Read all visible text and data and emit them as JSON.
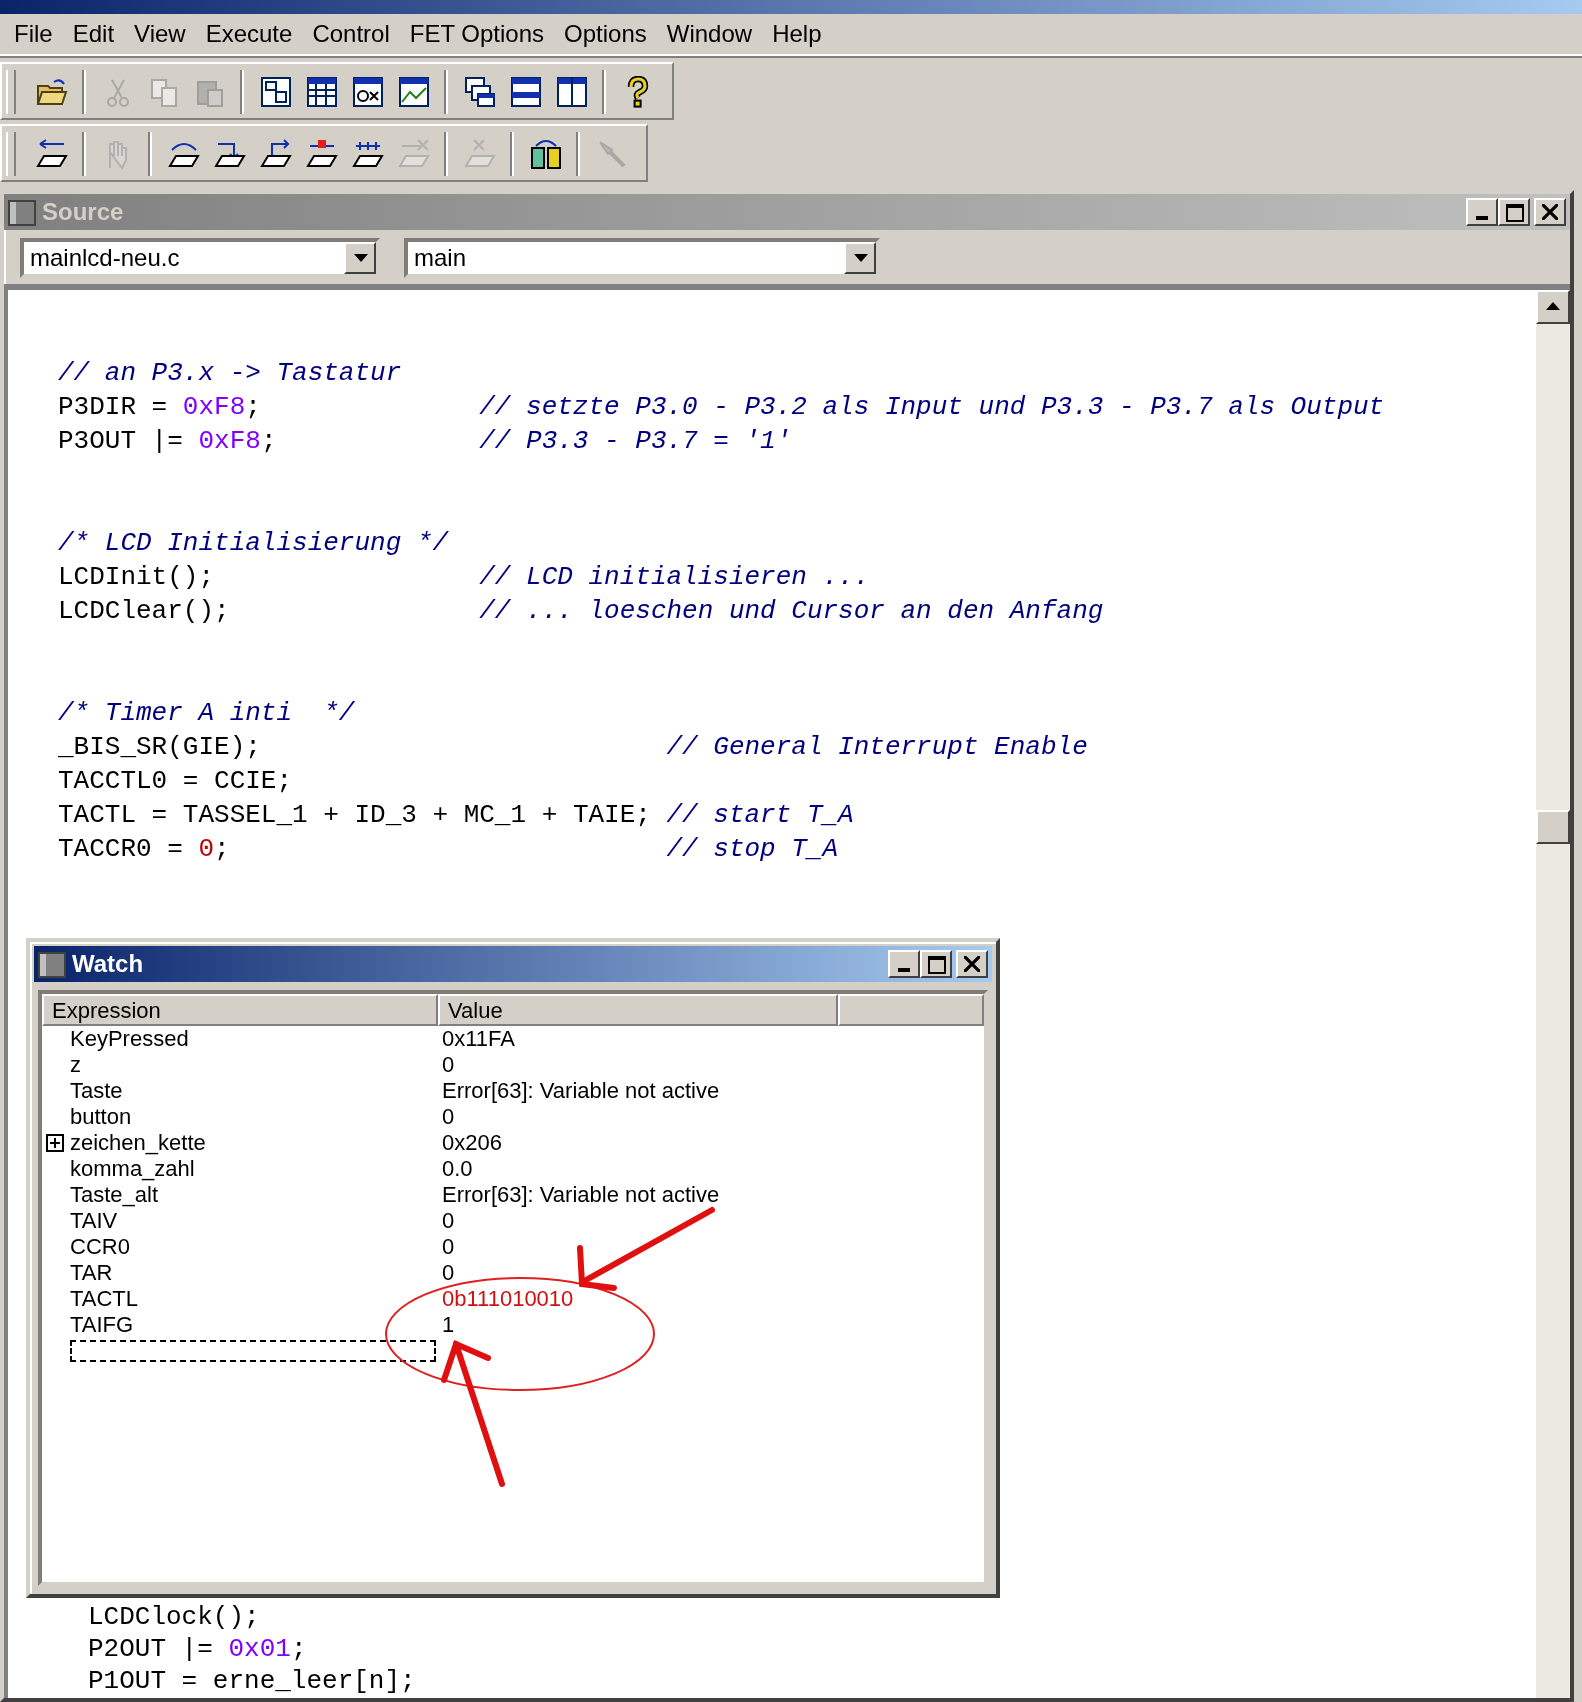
{
  "menu": [
    "File",
    "Edit",
    "View",
    "Execute",
    "Control",
    "FET Options",
    "Options",
    "Window",
    "Help"
  ],
  "toolbars": [
    {
      "groups": [
        [
          {
            "disabled": false
          }
        ],
        [
          {
            "disabled": true
          },
          {
            "disabled": true
          },
          {
            "disabled": true
          }
        ],
        [
          {
            "disabled": false
          },
          {
            "disabled": false
          },
          {
            "disabled": false
          },
          {
            "disabled": false
          }
        ],
        [
          {
            "disabled": false
          },
          {
            "disabled": false
          },
          {
            "disabled": false
          }
        ],
        [
          {
            "disabled": false
          }
        ]
      ]
    },
    {
      "groups": [
        [
          {
            "disabled": false
          }
        ],
        [
          {
            "disabled": true
          }
        ],
        [
          {
            "disabled": false
          },
          {
            "disabled": false
          },
          {
            "disabled": false
          },
          {
            "disabled": false
          },
          {
            "disabled": false
          },
          {
            "disabled": true
          }
        ],
        [
          {
            "disabled": true
          }
        ],
        [
          {
            "disabled": false
          }
        ],
        [
          {
            "disabled": true
          }
        ]
      ]
    }
  ],
  "source_window": {
    "title": "Source",
    "file_combo": "mainlcd-neu.c",
    "function_combo": "main",
    "code_blocks": [
      {
        "lines": [
          {
            "segments": [
              {
                "kind": "comment",
                "text": "// an P3.x -> Tastatur"
              }
            ]
          },
          {
            "segments": [
              {
                "kind": "plain",
                "text": "P3DIR = "
              },
              {
                "kind": "number",
                "text": "0xF8"
              },
              {
                "kind": "plain",
                "text": ";"
              }
            ],
            "comment": "// setzte P3.0 - P3.2 als Input und P3.3 - P3.7 als Output"
          },
          {
            "segments": [
              {
                "kind": "plain",
                "text": "P3OUT |= "
              },
              {
                "kind": "number",
                "text": "0xF8"
              },
              {
                "kind": "plain",
                "text": ";"
              }
            ],
            "comment": "// P3.3 - P3.7 = '1'"
          }
        ]
      },
      {
        "lines": [
          {
            "segments": [
              {
                "kind": "comment",
                "text": "/* LCD Initialisierung */"
              }
            ]
          },
          {
            "segments": [
              {
                "kind": "plain",
                "text": "LCDInit();"
              }
            ],
            "comment": "// LCD initialisieren ..."
          },
          {
            "segments": [
              {
                "kind": "plain",
                "text": "LCDClear();"
              }
            ],
            "comment": "// ... loeschen und Cursor an den Anfang"
          }
        ]
      },
      {
        "lines": [
          {
            "segments": [
              {
                "kind": "comment",
                "text": "/* Timer A inti  */"
              }
            ]
          },
          {
            "segments": [
              {
                "kind": "plain",
                "text": "_BIS_SR(GIE);"
              }
            ],
            "comment": "// General Interrupt Enable"
          },
          {
            "segments": [
              {
                "kind": "plain",
                "text": "TACCTL0 = CCIE;"
              }
            ]
          },
          {
            "segments": [
              {
                "kind": "plain",
                "text": "TACTL = TASSEL_1 + ID_3 + MC_1 + TAIE;"
              }
            ],
            "comment": "// start T_A"
          },
          {
            "segments": [
              {
                "kind": "plain",
                "text": "TACCR0 = "
              },
              {
                "kind": "zero",
                "text": "0"
              },
              {
                "kind": "plain",
                "text": ";"
              }
            ],
            "comment": "// stop T_A"
          }
        ]
      },
      {
        "lines": [
          {
            "segments": [
              {
                "kind": "plain",
                "text": "LCDClock();"
              }
            ]
          },
          {
            "segments": [
              {
                "kind": "plain",
                "text": "P2OUT |= "
              },
              {
                "kind": "number",
                "text": "0x01"
              },
              {
                "kind": "plain",
                "text": ";"
              }
            ]
          },
          {
            "segments": [
              {
                "kind": "plain",
                "text": "P1OUT = erne_leer[n];"
              }
            ]
          }
        ]
      }
    ]
  },
  "watch_window": {
    "title": "Watch",
    "columns": [
      "Expression",
      "Value"
    ],
    "rows": [
      {
        "expression": "KeyPressed",
        "value": "0x11FA",
        "expandable": false,
        "changed": false
      },
      {
        "expression": "z",
        "value": "0",
        "expandable": false,
        "changed": false
      },
      {
        "expression": "Taste",
        "value": "Error[63]: Variable not active",
        "expandable": false,
        "changed": false
      },
      {
        "expression": "button",
        "value": "0",
        "expandable": false,
        "changed": false
      },
      {
        "expression": "zeichen_kette",
        "value": "0x206",
        "expandable": true,
        "changed": false
      },
      {
        "expression": "komma_zahl",
        "value": "0.0",
        "expandable": false,
        "changed": false
      },
      {
        "expression": "Taste_alt",
        "value": "Error[63]: Variable not active",
        "expandable": false,
        "changed": false
      },
      {
        "expression": "TAIV",
        "value": "0",
        "expandable": false,
        "changed": false
      },
      {
        "expression": "CCR0",
        "value": "0",
        "expandable": false,
        "changed": false
      },
      {
        "expression": "TAR",
        "value": "0",
        "expandable": false,
        "changed": false
      },
      {
        "expression": "TACTL",
        "value": "0b111010010",
        "expandable": false,
        "changed": true
      },
      {
        "expression": "TAIFG",
        "value": "1",
        "expandable": false,
        "changed": false
      }
    ]
  }
}
